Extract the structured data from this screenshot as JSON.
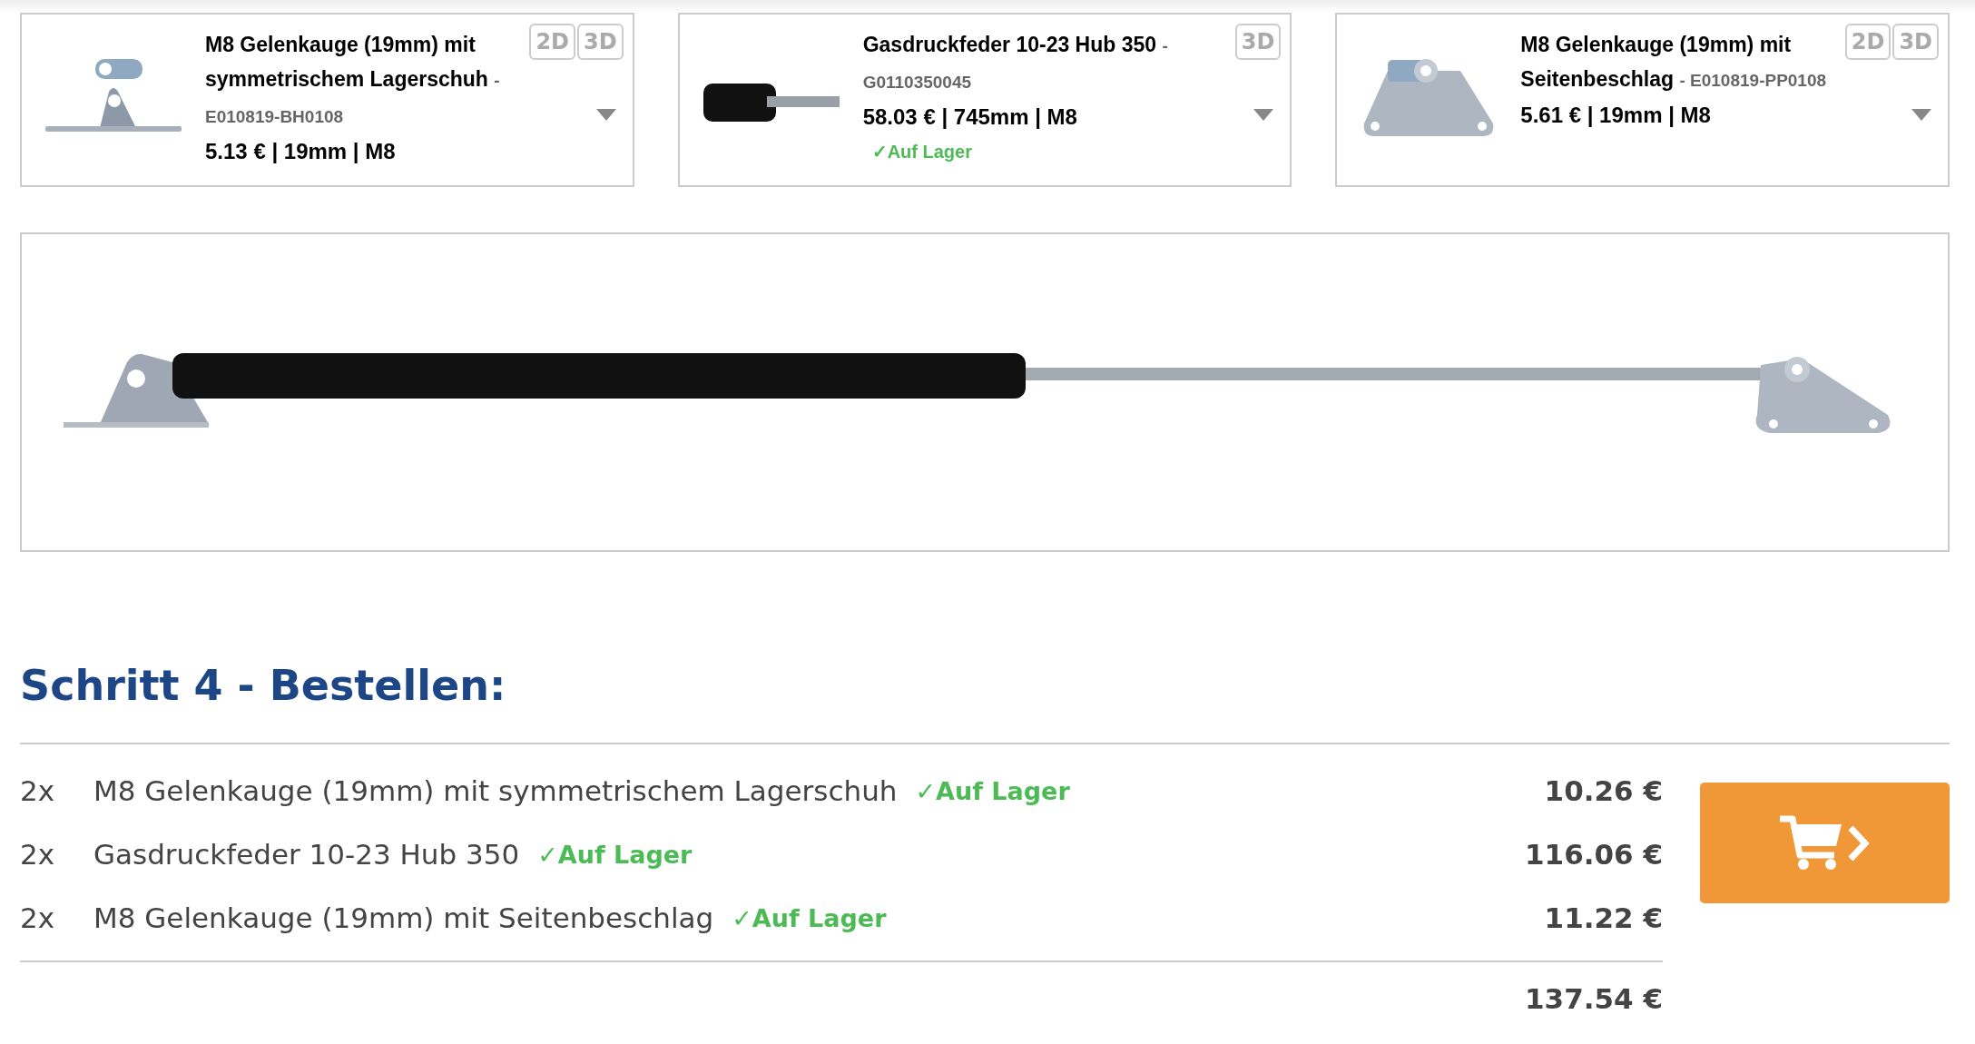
{
  "products": [
    {
      "kind": "eye-bracket",
      "title": "M8 Gelenkauge (19mm) mit symmetrischem Lagerschuh",
      "code": "- E010819-BH0108",
      "specs": "5.13 € | 19mm | M8",
      "views": [
        "2D",
        "3D"
      ]
    },
    {
      "kind": "spring",
      "title": "Gasdruckfeder 10-23 Hub 350",
      "code": "- G0110350045",
      "specs": "58.03 € | 745mm | M8",
      "views": [
        "3D"
      ],
      "stock": "✓Auf Lager"
    },
    {
      "kind": "side-bracket",
      "title": "M8 Gelenkauge (19mm) mit Seitenbeschlag",
      "code": "- E010819-PP0108",
      "specs": "5.61 € | 19mm | M8",
      "views": [
        "2D",
        "3D"
      ]
    }
  ],
  "step_heading": "**Schritt 4** - Bestellen:",
  "order": {
    "rows": [
      {
        "qty": "2x",
        "name": "M8 Gelenkauge (19mm) mit symmetrischem Lagerschuh",
        "stock": "✓Auf Lager",
        "price": "10.26 €"
      },
      {
        "qty": "2x",
        "name": "Gasdruckfeder 10-23 Hub 350",
        "stock": "✓Auf Lager",
        "price": "116.06 €"
      },
      {
        "qty": "2x",
        "name": "M8 Gelenkauge (19mm) mit Seitenbeschlag",
        "stock": "✓Auf Lager",
        "price": "11.22 €"
      }
    ],
    "total": "137.54 €"
  }
}
